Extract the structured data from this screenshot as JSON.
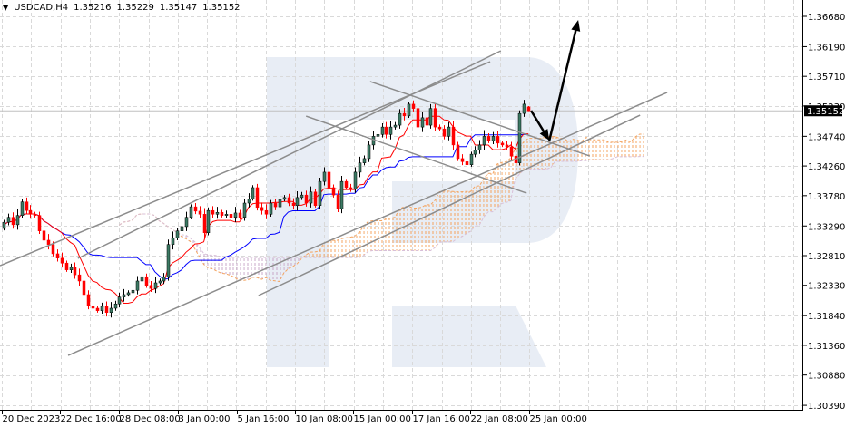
{
  "header": {
    "menu_icon": "triangle-down-icon",
    "symbol": "USDCAD,H4",
    "open": "1.35216",
    "high": "1.35229",
    "low": "1.35147",
    "close": "1.35152"
  },
  "colors": {
    "bull": "#3c7a64",
    "bear": "#ff0000",
    "tenkan": "#ff0000",
    "kijun": "#0000ff",
    "span_a": "#f4a460",
    "span_b": "#d8bfd8",
    "trendline": "#8c8c8c",
    "arrow": "#000000",
    "watermark": "#e8edf5",
    "grid": "#d9d9d9"
  },
  "chart_data": {
    "type": "candlestick",
    "title": "USDCAD,H4",
    "indicators": [
      "Ichimoku Kinko Hyo (9,26,52)"
    ],
    "ylim": [
      1.30318,
      1.36944
    ],
    "grid": true,
    "first_open": 1.3325,
    "closes": [
      1.3335,
      1.3343,
      1.3331,
      1.3346,
      1.3368,
      1.3354,
      1.3348,
      1.3346,
      1.3321,
      1.3306,
      1.3299,
      1.3284,
      1.3277,
      1.3269,
      1.3258,
      1.3262,
      1.325,
      1.324,
      1.3218,
      1.32,
      1.3196,
      1.3192,
      1.3199,
      1.3189,
      1.3196,
      1.3203,
      1.3214,
      1.3218,
      1.3221,
      1.3225,
      1.324,
      1.3247,
      1.3233,
      1.3228,
      1.3237,
      1.324,
      1.3247,
      1.3299,
      1.331,
      1.3321,
      1.3328,
      1.3343,
      1.336,
      1.3353,
      1.3348,
      1.3318,
      1.3354,
      1.3348,
      1.3351,
      1.3346,
      1.3348,
      1.3343,
      1.335,
      1.3343,
      1.3366,
      1.3373,
      1.3391,
      1.3359,
      1.3354,
      1.3348,
      1.3366,
      1.336,
      1.3372,
      1.3375,
      1.3366,
      1.3362,
      1.3375,
      1.3379,
      1.3366,
      1.3384,
      1.3362,
      1.3401,
      1.3416,
      1.3391,
      1.3379,
      1.3357,
      1.3401,
      1.3391,
      1.3389,
      1.3416,
      1.3431,
      1.3438,
      1.346,
      1.3474,
      1.3477,
      1.3489,
      1.3477,
      1.3489,
      1.3492,
      1.3511,
      1.3507,
      1.3526,
      1.3519,
      1.3489,
      1.3504,
      1.3492,
      1.3519,
      1.3489,
      1.3486,
      1.3474,
      1.3489,
      1.346,
      1.3438,
      1.3433,
      1.3428,
      1.3445,
      1.3452,
      1.346,
      1.3474,
      1.3467,
      1.3474,
      1.3463,
      1.346,
      1.3457,
      1.3442,
      1.3431,
      1.3511,
      1.3526,
      1.3522
    ],
    "last_candle": {
      "open": 1.35216,
      "high": 1.35229,
      "low": 1.35147,
      "close": 1.35152
    },
    "current_price": "1.35152",
    "y_ticks": [
      "1.36680",
      "1.36190",
      "1.35710",
      "1.35230",
      "1.34740",
      "1.34260",
      "1.33780",
      "1.33290",
      "1.32810",
      "1.32330",
      "1.31840",
      "1.31360",
      "1.30880",
      "1.30390"
    ],
    "x_ticks": [
      {
        "label": "20 Dec 2023",
        "index": -0.4
      },
      {
        "label": "22 Dec 16:00",
        "index": 12.7
      },
      {
        "label": "28 Dec 08:00",
        "index": 25.9
      },
      {
        "label": "3 Jan 00:00",
        "index": 39.2
      },
      {
        "label": "5 Jan 16:00",
        "index": 52.4
      },
      {
        "label": "10 Jan 08:00",
        "index": 65.5
      },
      {
        "label": "15 Jan 00:00",
        "index": 78.6
      },
      {
        "label": "17 Jan 16:00",
        "index": 91.8
      },
      {
        "label": "22 Jan 08:00",
        "index": 104.9
      },
      {
        "label": "25 Jan 00:00",
        "index": 118.2
      }
    ],
    "trendlines": [
      {
        "name": "ascending-channel-upper-1",
        "from": [
          -0.8,
          1.32648
        ],
        "to": [
          109.4,
          1.35947
        ]
      },
      {
        "name": "ascending-channel-upper-2",
        "from": [
          16.7,
          1.32766
        ],
        "to": [
          111.8,
          1.36123
        ]
      },
      {
        "name": "ascending-channel-lower-1",
        "from": [
          14.5,
          1.31197
        ],
        "to": [
          149.2,
          1.35449
        ]
      },
      {
        "name": "ascending-channel-lower-2",
        "from": [
          57.3,
          1.32165
        ],
        "to": [
          143.1,
          1.35082
        ]
      },
      {
        "name": "descending-channel-upper",
        "from": [
          82.4,
          1.35625
        ],
        "to": [
          131.8,
          1.34422
        ]
      },
      {
        "name": "descending-channel-lower",
        "from": [
          68.0,
          1.35067
        ],
        "to": [
          117.6,
          1.33821
        ]
      }
    ],
    "arrows": [
      {
        "name": "forecast-arrow-down",
        "from": [
          118.6,
          1.35155
        ],
        "to": [
          122.7,
          1.34672
        ]
      },
      {
        "name": "forecast-arrow-up",
        "from": [
          122.7,
          1.34672
        ],
        "to": [
          129.2,
          1.36621
        ]
      }
    ]
  }
}
